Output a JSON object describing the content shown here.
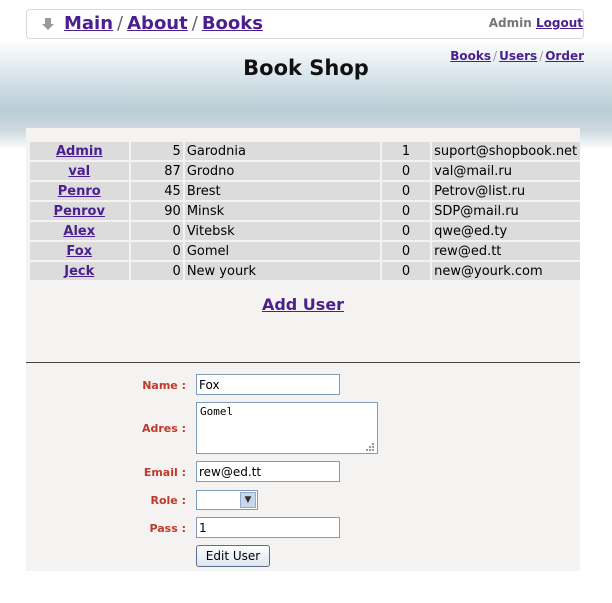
{
  "nav": {
    "breadcrumb": [
      "Main",
      "About",
      "Books"
    ],
    "separator": "/",
    "user_name": "Admin",
    "logout_label": "Logout"
  },
  "page": {
    "title": "Book Shop"
  },
  "subnav": {
    "items": [
      "Books",
      "Users",
      "Order"
    ],
    "separator": "/"
  },
  "users_table": {
    "rows": [
      {
        "login": "Admin",
        "num": "5",
        "city": "Garodnia",
        "role": "1",
        "email": "suport@shopbook.net"
      },
      {
        "login": "val",
        "num": "87",
        "city": "Grodno",
        "role": "0",
        "email": "val@mail.ru"
      },
      {
        "login": "Penro",
        "num": "45",
        "city": "Brest",
        "role": "0",
        "email": "Petrov@list.ru"
      },
      {
        "login": "Penrov",
        "num": "90",
        "city": "Minsk",
        "role": "0",
        "email": "SDP@mail.ru"
      },
      {
        "login": "Alex",
        "num": "0",
        "city": "Vitebsk",
        "role": "0",
        "email": "qwe@ed.ty"
      },
      {
        "login": "Fox",
        "num": "0",
        "city": "Gomel",
        "role": "0",
        "email": "rew@ed.tt"
      },
      {
        "login": "Jeck",
        "num": "0",
        "city": "New yourk",
        "role": "0",
        "email": "new@yourk.com"
      }
    ]
  },
  "add_user_label": "Add User",
  "form": {
    "name_label": "Name :",
    "name_value": "Fox",
    "adres_label": "Adres :",
    "adres_value": "Gomel",
    "email_label": "Email :",
    "email_value": "rew@ed.tt",
    "role_label": "Role :",
    "role_value": "",
    "pass_label": "Pass :",
    "pass_value": "1",
    "submit_label": "Edit User"
  },
  "colors": {
    "link": "#4b1f8f",
    "form_label": "#c0392b",
    "row_bg": "#dcdcdc"
  }
}
